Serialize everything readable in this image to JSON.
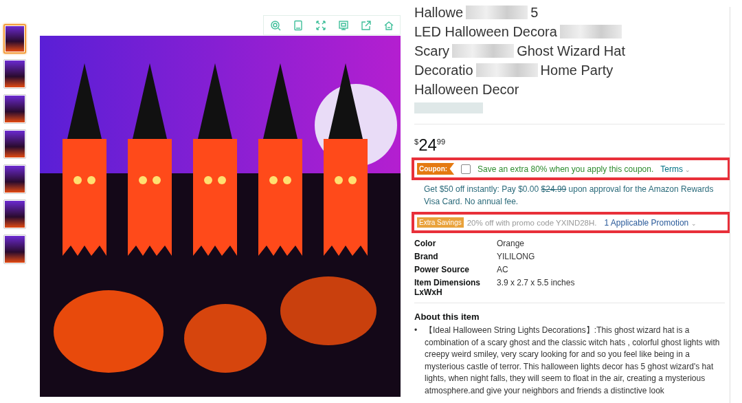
{
  "thumbnails": [
    {
      "selected": true
    },
    {
      "selected": false
    },
    {
      "selected": false
    },
    {
      "selected": false
    },
    {
      "selected": false
    },
    {
      "selected": false
    },
    {
      "selected": false
    }
  ],
  "toolbar": [
    {
      "kind": "search"
    },
    {
      "kind": "tablet"
    },
    {
      "kind": "expand"
    },
    {
      "kind": "save"
    },
    {
      "kind": "share"
    },
    {
      "kind": "home"
    }
  ],
  "title_lines": [
    [
      {
        "kind": "text",
        "text": "Hallowe"
      },
      {
        "kind": "blur"
      },
      {
        "kind": "text",
        "text": "5"
      }
    ],
    [
      {
        "kind": "text",
        "text": "LED Halloween Decora"
      },
      {
        "kind": "blur"
      }
    ],
    [
      {
        "kind": "text",
        "text": "Scary"
      },
      {
        "kind": "blur"
      },
      {
        "kind": "text",
        "text": "Ghost Wizard Hat"
      }
    ],
    [
      {
        "kind": "text",
        "text": "Decoratio"
      },
      {
        "kind": "blur"
      },
      {
        "kind": "text",
        "text": "Home Party"
      }
    ],
    [
      {
        "kind": "text",
        "text": "Halloween Decor"
      }
    ]
  ],
  "price": {
    "currency": "$",
    "whole": "24",
    "fraction": "99"
  },
  "coupon": {
    "badge": "Coupon:",
    "checked": false,
    "text": "Save an extra 80% when you apply this coupon.",
    "terms": "Terms",
    "terms_caret": "⌄"
  },
  "card_offer": {
    "lead": "Get $50 off instantly: Pay $0.00",
    "struck": "$24.99",
    "rest": "upon approval for the Amazon Rewards Visa Card. No annual fee."
  },
  "extra_savings": {
    "badge": "Extra Savings",
    "text": "20% off with promo code YXIND28H.",
    "link": "1 Applicable Promotion",
    "link_caret": "⌄"
  },
  "specs": [
    {
      "label": "Color",
      "value": "Orange"
    },
    {
      "label": "Brand",
      "value": "YILILONG"
    },
    {
      "label": "Power Source",
      "value": "AC"
    },
    {
      "label": "Item Dimensions LxWxH",
      "value": "3.9 x 2.7 x 5.5 inches"
    }
  ],
  "about": {
    "heading": "About this item",
    "bullet_marker": "•",
    "bullets": [
      "【Ideal Halloween String Lights Decorations】:This ghost wizard hat is a combination of a scary ghost and the classic witch hats , colorful ghost lights with creepy weird smiley, very scary looking for and so you feel like being in a mysterious castle of terror. This halloween lights decor has 5 ghost wizard's hat lights, when night falls, they will seem to float in the air, creating a mysterious atmosphere.and give your neighbors and friends a distinctive look"
    ]
  }
}
